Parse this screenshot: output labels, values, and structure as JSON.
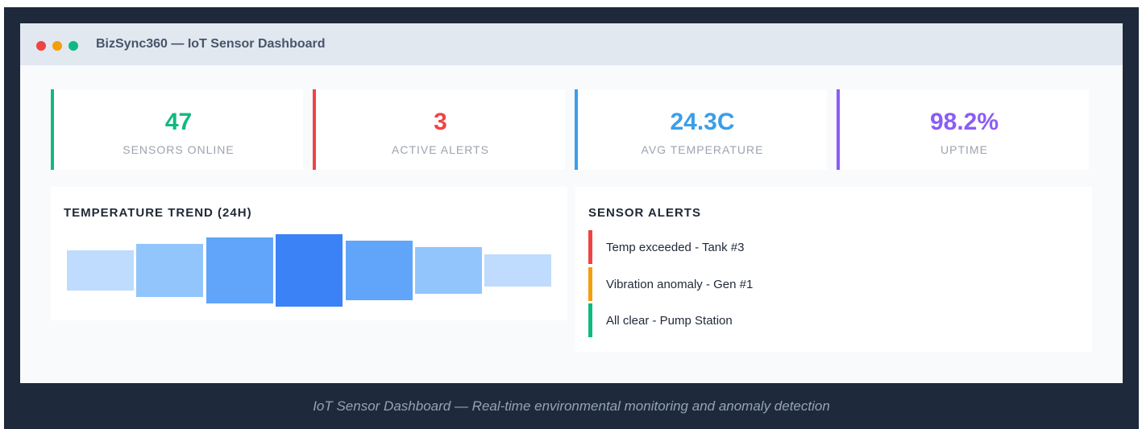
{
  "window": {
    "title": "BizSync360 — IoT Sensor Dashboard",
    "controls": [
      {
        "name": "close",
        "color": "#ef4444"
      },
      {
        "name": "minimize",
        "color": "#f59e0b"
      },
      {
        "name": "maximize",
        "color": "#10b981"
      }
    ]
  },
  "stats": [
    {
      "value": "47",
      "label": "SENSORS ONLINE",
      "color": "#10b981"
    },
    {
      "value": "3",
      "label": "ACTIVE ALERTS",
      "color": "#ef4444"
    },
    {
      "value": "24.3C",
      "label": "AVG TEMPERATURE",
      "color": "#3b9eea"
    },
    {
      "value": "98.2%",
      "label": "UPTIME",
      "color": "#8b5cf6"
    }
  ],
  "trend": {
    "title": "TEMPERATURE TREND (24H)",
    "chart_data": {
      "type": "bar",
      "values": [
        0.55,
        0.73,
        0.91,
        1.0,
        0.82,
        0.64,
        0.45
      ],
      "colors": [
        "#bfdbfe",
        "#93c5fd",
        "#60a5fa",
        "#3b82f6",
        "#60a5fa",
        "#93c5fd",
        "#bfdbfe"
      ]
    }
  },
  "alerts": {
    "title": "SENSOR ALERTS",
    "items": [
      {
        "text": "Temp exceeded - Tank #3",
        "color": "#ef4444"
      },
      {
        "text": "Vibration anomaly - Gen #1",
        "color": "#f59e0b"
      },
      {
        "text": "All clear - Pump Station",
        "color": "#10b981"
      }
    ]
  },
  "caption": "IoT Sensor Dashboard — Real-time environmental monitoring and anomaly detection"
}
